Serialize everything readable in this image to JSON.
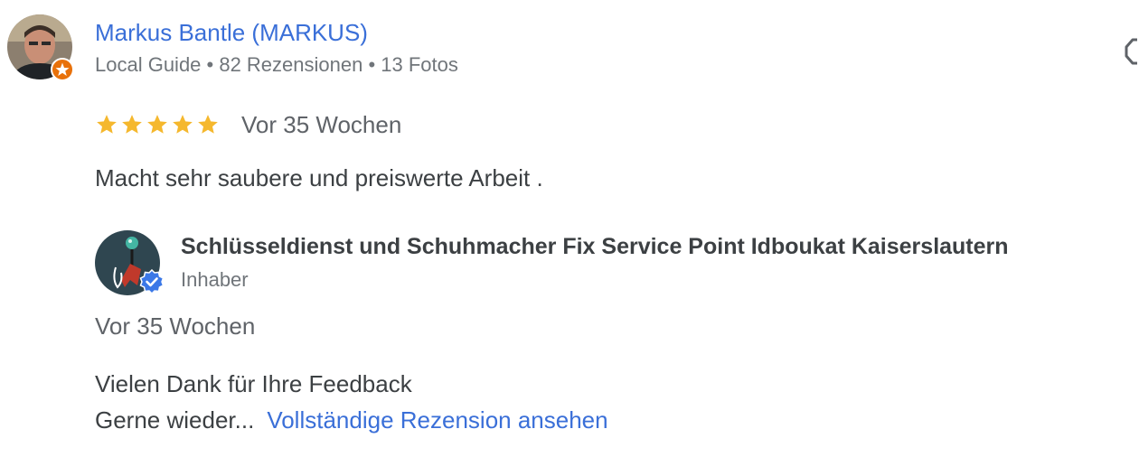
{
  "review": {
    "reviewer": {
      "name": "Markus Bantle (MARKUS)",
      "meta": "Local Guide • 82 Rezensionen • 13 Fotos"
    },
    "rating": 5,
    "date": "Vor 35 Wochen",
    "text": "Macht sehr saubere und preiswerte Arbeit ."
  },
  "owner_response": {
    "name": "Schlüsseldienst und Schuhmacher Fix Service Point Idboukat Kaiserslautern",
    "role": "Inhaber",
    "date": "Vor 35 Wochen",
    "line1": "Vielen Dank für Ihre Feedback",
    "line2": "Gerne wieder...",
    "more_link": "Vollständige Rezension ansehen"
  },
  "icons": {
    "star": "star-icon",
    "local_guide_badge": "local-guide-badge-icon",
    "verified_badge": "verified-check-icon",
    "menu": "more-options-icon"
  },
  "colors": {
    "link": "#3a6fd8",
    "star": "#f5b82e",
    "guide_badge": "#e8710a",
    "verified": "#3b78e7",
    "secondary_text": "#70757a"
  }
}
